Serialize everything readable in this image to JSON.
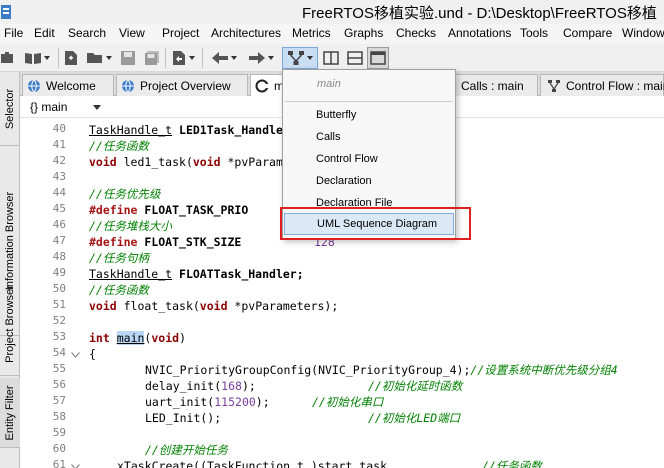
{
  "window": {
    "title": "FreeRTOS移植实验.und - D:\\Desktop\\FreeRTOS移植"
  },
  "menubar": {
    "items": [
      "File",
      "Edit",
      "Search",
      "View",
      "Project",
      "Architectures",
      "Metrics",
      "Graphs",
      "Checks",
      "Annotations",
      "Tools",
      "Compare",
      "Window"
    ]
  },
  "sidebar": {
    "tabs": [
      "Selector",
      "Information Browser",
      "Project Browser",
      "Entity Filter"
    ]
  },
  "tabs": {
    "items": [
      "Welcome",
      "Project Overview",
      "ma",
      "Calls : main",
      "Control Flow : main"
    ]
  },
  "editor": {
    "scope": "main"
  },
  "code": {
    "line_numbers": [
      "40",
      "41",
      "42",
      "43",
      "44",
      "45",
      "46",
      "47",
      "48",
      "49",
      "50",
      "51",
      "52",
      "53",
      "54",
      "55",
      "56",
      "57",
      "58",
      "59",
      "60",
      "61"
    ],
    "lines": [
      [
        "TaskHandle_t",
        " LED1Task_Handle"
      ],
      [
        "//任务函数"
      ],
      [
        "void",
        " led1_task(",
        "void",
        " *pvParam"
      ],
      [
        ""
      ],
      [
        "//任务优先级"
      ],
      [
        "#define",
        " FLOAT_TASK_PRIO"
      ],
      [
        "//任务堆栈大小"
      ],
      [
        "#define",
        " FLOAT_STK_SIZE",
        "128"
      ],
      [
        "//任务句柄"
      ],
      [
        "TaskHandle_t",
        " FLOATTask_Handler;"
      ],
      [
        "//任务函数"
      ],
      [
        "void",
        " float_task(",
        "void",
        " *pvParameters);"
      ],
      [
        ""
      ],
      [
        "int",
        " ",
        "main",
        "(",
        "void",
        ")"
      ],
      [
        "{"
      ],
      [
        "NVIC_PriorityGroupConfig(NVIC_PriorityGroup_4);",
        "//设置系统中断优先级分组4"
      ],
      [
        "delay_init(",
        "168",
        ");",
        "//初始化延时函数"
      ],
      [
        "uart_init(",
        "115200",
        ");",
        "//初始化串口"
      ],
      [
        "LED_Init();",
        "//初始化LED端口"
      ],
      [
        ""
      ],
      [
        "//创建开始任务"
      ],
      [
        "xTaskCreate((TaskFunction_t )start_task,",
        "//任务函数"
      ]
    ]
  },
  "dropdown": {
    "header": "main",
    "items": [
      "Butterfly",
      "Calls",
      "Control Flow",
      "Declaration",
      "Declaration File",
      "UML Sequence Diagram"
    ],
    "selected": "UML Sequence Diagram"
  },
  "colors": {
    "highlight_box": "#e02020",
    "selection": "#dbe8f6",
    "comment": "#008000",
    "keyword": "#8b0000"
  }
}
